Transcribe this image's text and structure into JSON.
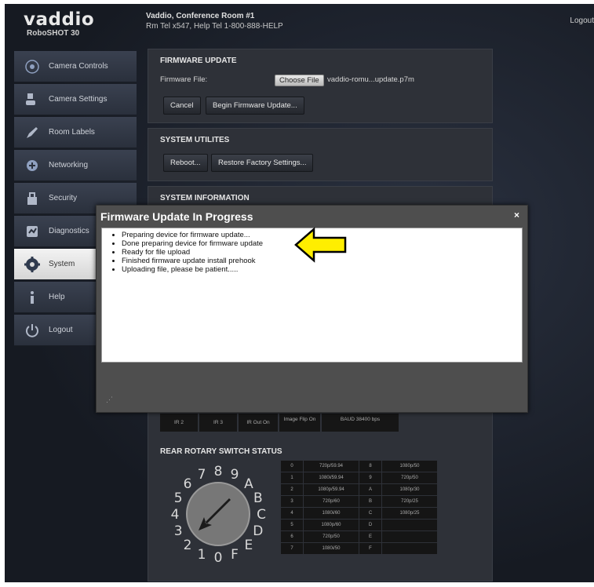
{
  "header": {
    "brand": "vaddio",
    "model": "RoboSHOT 30",
    "title": "Vaddio, Conference Room #1",
    "subtitle": "Rm Tel x547, Help Tel 1-800-888-HELP",
    "logout": "Logout"
  },
  "sidebar": {
    "items": [
      {
        "label": "Camera Controls",
        "icon": "camera-controls-icon"
      },
      {
        "label": "Camera Settings",
        "icon": "camera-settings-icon"
      },
      {
        "label": "Room Labels",
        "icon": "pen-icon"
      },
      {
        "label": "Networking",
        "icon": "network-icon"
      },
      {
        "label": "Security",
        "icon": "security-icon"
      },
      {
        "label": "Diagnostics",
        "icon": "diagnostics-icon"
      },
      {
        "label": "System",
        "icon": "gear-icon"
      },
      {
        "label": "Help",
        "icon": "help-icon"
      },
      {
        "label": "Logout",
        "icon": "power-icon"
      }
    ],
    "active": "System"
  },
  "firmware": {
    "heading": "FIRMWARE UPDATE",
    "file_label": "Firmware File:",
    "choose_label": "Choose File",
    "file_name": "vaddio-romu...update.p7m",
    "cancel_label": "Cancel",
    "begin_label": "Begin Firmware Update..."
  },
  "utilities": {
    "heading": "SYSTEM UTILITES",
    "reboot_label": "Reboot...",
    "restore_label": "Restore Factory Settings..."
  },
  "sysinfo": {
    "heading": "SYSTEM INFORMATION"
  },
  "modal": {
    "title": "Firmware Update In Progress",
    "close": "×",
    "messages": [
      "Preparing device for firmware update...",
      "Done preparing device for firmware update",
      "Ready for file upload",
      "Finished firmware update install prehook",
      "Uploading file, please be patient....."
    ],
    "arrow_color": "#ffee00"
  },
  "dip": {
    "cells": [
      "IR 2",
      "IR 3",
      "IR Out On",
      "Image Flip On",
      "BAUD 38400 bps"
    ]
  },
  "rotary": {
    "heading": "REAR ROTARY SWITCH STATUS",
    "dial_labels": [
      "0",
      "1",
      "2",
      "3",
      "4",
      "5",
      "6",
      "7",
      "8",
      "9",
      "A",
      "B",
      "C",
      "D",
      "E",
      "F"
    ],
    "rows": [
      [
        "0",
        "720p/59.94",
        "8",
        "1080p/50"
      ],
      [
        "1",
        "1080i/59.94",
        "9",
        "720p/50"
      ],
      [
        "2",
        "1080p/59.94",
        "A",
        "1080p/30"
      ],
      [
        "3",
        "720p/60",
        "B",
        "720p/25"
      ],
      [
        "4",
        "1080i/60",
        "C",
        "1080p/25"
      ],
      [
        "5",
        "1080p/60",
        "D",
        ""
      ],
      [
        "6",
        "720p/50",
        "E",
        ""
      ],
      [
        "7",
        "1080i/50",
        "F",
        ""
      ]
    ]
  }
}
